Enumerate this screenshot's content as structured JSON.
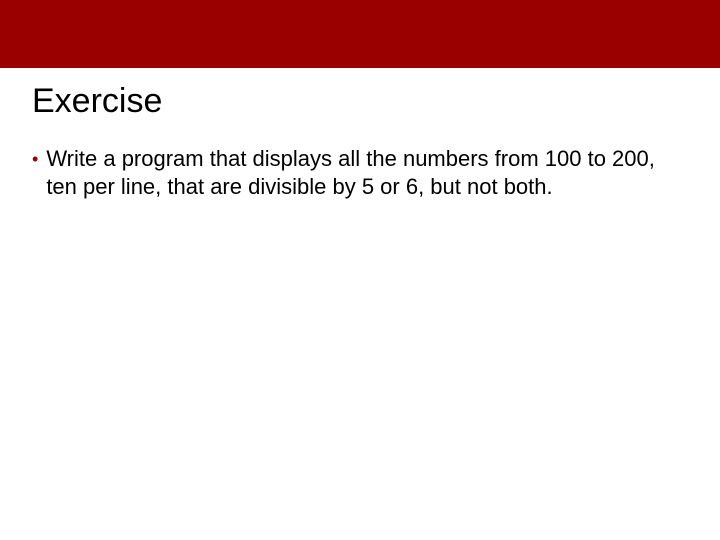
{
  "banner_color": "#9a0000",
  "title": "Exercise",
  "bullets": [
    {
      "text": "Write a program that displays all the numbers from 100 to 200, ten per line, that are divisible by 5 or 6, but not both."
    }
  ]
}
